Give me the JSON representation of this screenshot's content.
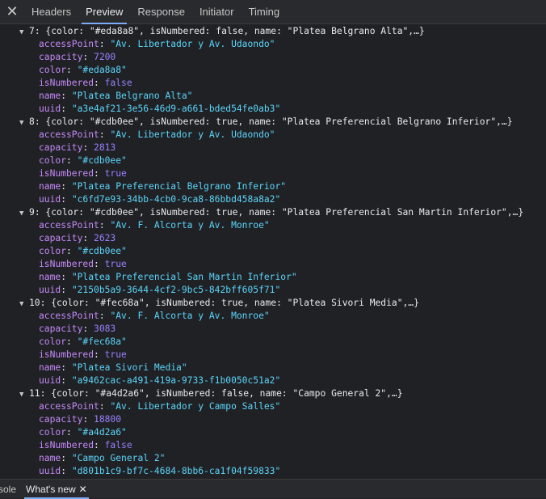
{
  "tabs": {
    "close": "✕",
    "items": [
      "Headers",
      "Preview",
      "Response",
      "Initiator",
      "Timing"
    ],
    "active": "Preview"
  },
  "keys": {
    "accessPoint": "accessPoint",
    "capacity": "capacity",
    "color": "color",
    "isNumbered": "isNumbered",
    "name": "name",
    "uuid": "uuid"
  },
  "entries": [
    {
      "index": "7",
      "summary": "{color: \"#eda8a8\", isNumbered: false, name: \"Platea Belgrano Alta\",…}",
      "accessPoint": "\"Av. Libertador y Av. Udaondo\"",
      "capacity": "7200",
      "color": "\"#eda8a8\"",
      "isNumbered": "false",
      "name": "\"Platea Belgrano Alta\"",
      "uuid": "\"a3e4af21-3e56-46d9-a661-bded54fe0ab3\""
    },
    {
      "index": "8",
      "summary": "{color: \"#cdb0ee\", isNumbered: true, name: \"Platea Preferencial Belgrano Inferior\",…}",
      "accessPoint": "\"Av. Libertador y Av. Udaondo\"",
      "capacity": "2813",
      "color": "\"#cdb0ee\"",
      "isNumbered": "true",
      "name": "\"Platea Preferencial Belgrano Inferior\"",
      "uuid": "\"c6fd7e93-34bb-4cb0-9ca8-86bbd458a8a2\""
    },
    {
      "index": "9",
      "summary": "{color: \"#cdb0ee\", isNumbered: true, name: \"Platea Preferencial San Martin Inferior\",…}",
      "accessPoint": "\"Av. F. Alcorta y Av. Monroe\"",
      "capacity": "2623",
      "color": "\"#cdb0ee\"",
      "isNumbered": "true",
      "name": "\"Platea Preferencial San Martin Inferior\"",
      "uuid": "\"2150b5a9-3644-4cf2-9bc5-842bff605f71\""
    },
    {
      "index": "10",
      "summary": "{color: \"#fec68a\", isNumbered: true, name: \"Platea Sivori Media\",…}",
      "accessPoint": "\"Av. F. Alcorta y Av. Monroe\"",
      "capacity": "3083",
      "color": "\"#fec68a\"",
      "isNumbered": "true",
      "name": "\"Platea Sivori Media\"",
      "uuid": "\"a9462cac-a491-419a-9733-f1b0050c51a2\""
    },
    {
      "index": "11",
      "summary": "{color: \"#a4d2a6\", isNumbered: false, name: \"Campo General 2\",…}",
      "accessPoint": "\"Av. Libertador y Campo Salles\"",
      "capacity": "18800",
      "color": "\"#a4d2a6\"",
      "isNumbered": "false",
      "name": "\"Campo General 2\"",
      "uuid": "\"d801b1c9-bf7c-4684-8bb6-ca1f04f59833\""
    }
  ],
  "drawer": {
    "console": "sole",
    "whats_new": "What's new",
    "close": "✕"
  }
}
